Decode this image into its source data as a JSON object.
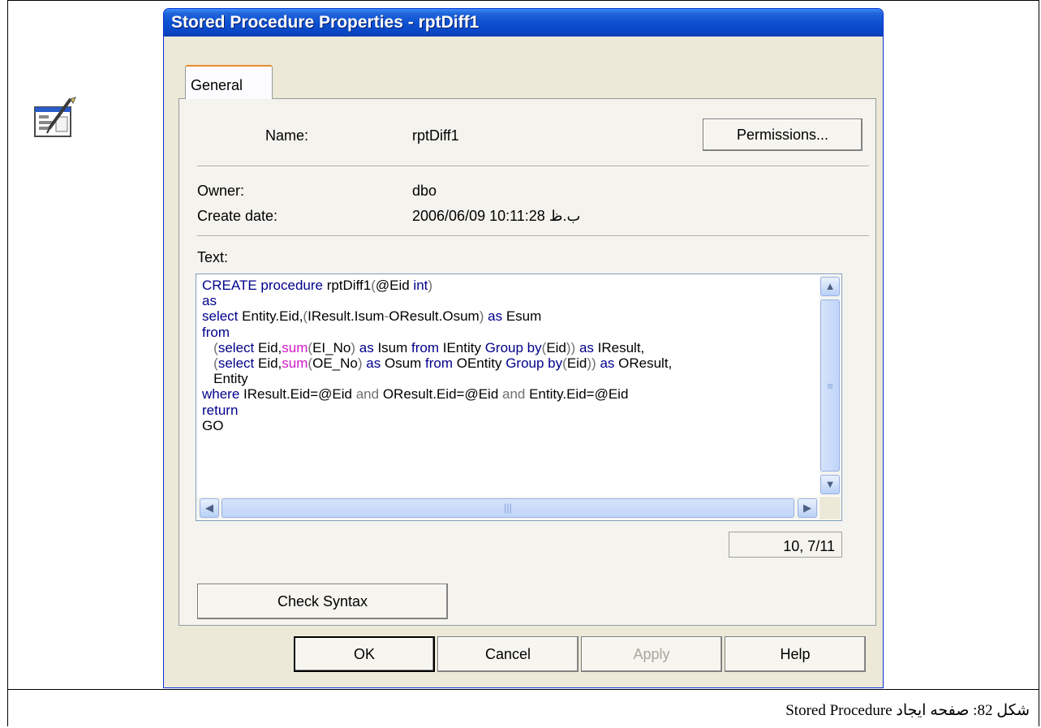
{
  "dialog": {
    "title": "Stored Procedure Properties - rptDiff1",
    "tabs": [
      {
        "label": "General",
        "active": true
      }
    ],
    "name_label": "Name:",
    "name_value": "rptDiff1",
    "permissions_button": "Permissions...",
    "owner_label": "Owner:",
    "owner_value": "dbo",
    "create_date_label": "Create date:",
    "create_date_value": "2006/06/09 10:11:28 ب.ظ",
    "text_label": "Text:",
    "code_lines": [
      [
        {
          "t": "CREATE procedure",
          "c": "kw"
        },
        {
          "t": " rptDiff1"
        },
        {
          "t": "(",
          "c": "op"
        },
        {
          "t": "@Eid "
        },
        {
          "t": "int",
          "c": "kw"
        },
        {
          "t": ")",
          "c": "op"
        }
      ],
      [
        {
          "t": "as",
          "c": "kw"
        }
      ],
      [
        {
          "t": "select",
          "c": "kw"
        },
        {
          "t": " Entity.Eid,"
        },
        {
          "t": "(",
          "c": "op"
        },
        {
          "t": "IResult.Isum"
        },
        {
          "t": "-",
          "c": "op"
        },
        {
          "t": "OResult.Osum"
        },
        {
          "t": ")",
          "c": "op"
        },
        {
          "t": " "
        },
        {
          "t": "as",
          "c": "kw"
        },
        {
          "t": " Esum"
        }
      ],
      [
        {
          "t": "from",
          "c": "kw"
        }
      ],
      [
        {
          "t": "   "
        },
        {
          "t": "(",
          "c": "op"
        },
        {
          "t": "select",
          "c": "kw"
        },
        {
          "t": " Eid,"
        },
        {
          "t": "sum",
          "c": "fn"
        },
        {
          "t": "(",
          "c": "op"
        },
        {
          "t": "EI_No"
        },
        {
          "t": ")",
          "c": "op"
        },
        {
          "t": " "
        },
        {
          "t": "as",
          "c": "kw"
        },
        {
          "t": " Isum "
        },
        {
          "t": "from",
          "c": "kw"
        },
        {
          "t": " IEntity "
        },
        {
          "t": "Group by",
          "c": "kw"
        },
        {
          "t": "(",
          "c": "op"
        },
        {
          "t": "Eid"
        },
        {
          "t": "))",
          "c": "op"
        },
        {
          "t": " "
        },
        {
          "t": "as",
          "c": "kw"
        },
        {
          "t": " IResult,"
        }
      ],
      [
        {
          "t": "   "
        },
        {
          "t": "(",
          "c": "op"
        },
        {
          "t": "select",
          "c": "kw"
        },
        {
          "t": " Eid,"
        },
        {
          "t": "sum",
          "c": "fn"
        },
        {
          "t": "(",
          "c": "op"
        },
        {
          "t": "OE_No"
        },
        {
          "t": ")",
          "c": "op"
        },
        {
          "t": " "
        },
        {
          "t": "as",
          "c": "kw"
        },
        {
          "t": " Osum "
        },
        {
          "t": "from",
          "c": "kw"
        },
        {
          "t": " OEntity "
        },
        {
          "t": "Group by",
          "c": "kw"
        },
        {
          "t": "(",
          "c": "op"
        },
        {
          "t": "Eid"
        },
        {
          "t": "))",
          "c": "op"
        },
        {
          "t": " "
        },
        {
          "t": "as",
          "c": "kw"
        },
        {
          "t": " OResult,"
        }
      ],
      [
        {
          "t": "   Entity"
        }
      ],
      [
        {
          "t": "where",
          "c": "kw"
        },
        {
          "t": " IResult.Eid=@Eid "
        },
        {
          "t": "and",
          "c": "op"
        },
        {
          "t": " OResult.Eid=@Eid "
        },
        {
          "t": "and",
          "c": "op"
        },
        {
          "t": " Entity.Eid=@Eid"
        }
      ],
      [
        {
          "t": "return",
          "c": "kw"
        }
      ],
      [
        {
          "t": "GO"
        }
      ]
    ],
    "cursor_position": "10, 7/11",
    "check_syntax_button": "Check Syntax",
    "ok_button": "OK",
    "cancel_button": "Cancel",
    "apply_button": "Apply",
    "help_button": "Help"
  },
  "caption": "شکل 82: صفحه ایجاد Stored Procedure",
  "colors": {
    "keyword": "#00008b",
    "function": "#d218c8",
    "operator": "#707070",
    "title_bar": "#0a46c4"
  },
  "icons": {
    "procedure": "stored-procedure-icon",
    "scroll_up": "arrow-up-icon",
    "scroll_down": "arrow-down-icon",
    "scroll_left": "arrow-left-icon",
    "scroll_right": "arrow-right-icon"
  }
}
